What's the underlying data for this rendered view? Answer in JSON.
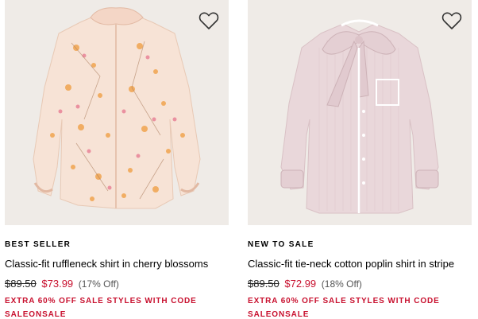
{
  "products": [
    {
      "badge": "BEST SELLER",
      "title": "Classic-fit ruffleneck shirt in cherry blossoms",
      "price_original": "$89.50",
      "price_sale": "$73.99",
      "discount": "(17% Off)",
      "promo": "EXTRA 60% OFF SALE STYLES WITH CODE SALEONSALE",
      "wishlist_icon": "heart-outline-icon",
      "image_background": "#efebe7",
      "shirt_color": "#f7e3d6"
    },
    {
      "badge": "NEW TO SALE",
      "title": "Classic-fit tie-neck cotton poplin shirt in stripe",
      "price_original": "$89.50",
      "price_sale": "$72.99",
      "discount": "(18% Off)",
      "promo": "EXTRA 60% OFF SALE STYLES WITH CODE SALEONSALE",
      "wishlist_icon": "heart-outline-icon",
      "image_background": "#efebe7",
      "shirt_color": "#e9d7da"
    }
  ],
  "colors": {
    "sale_red": "#c8102e",
    "text": "#000000",
    "muted": "#555555"
  }
}
